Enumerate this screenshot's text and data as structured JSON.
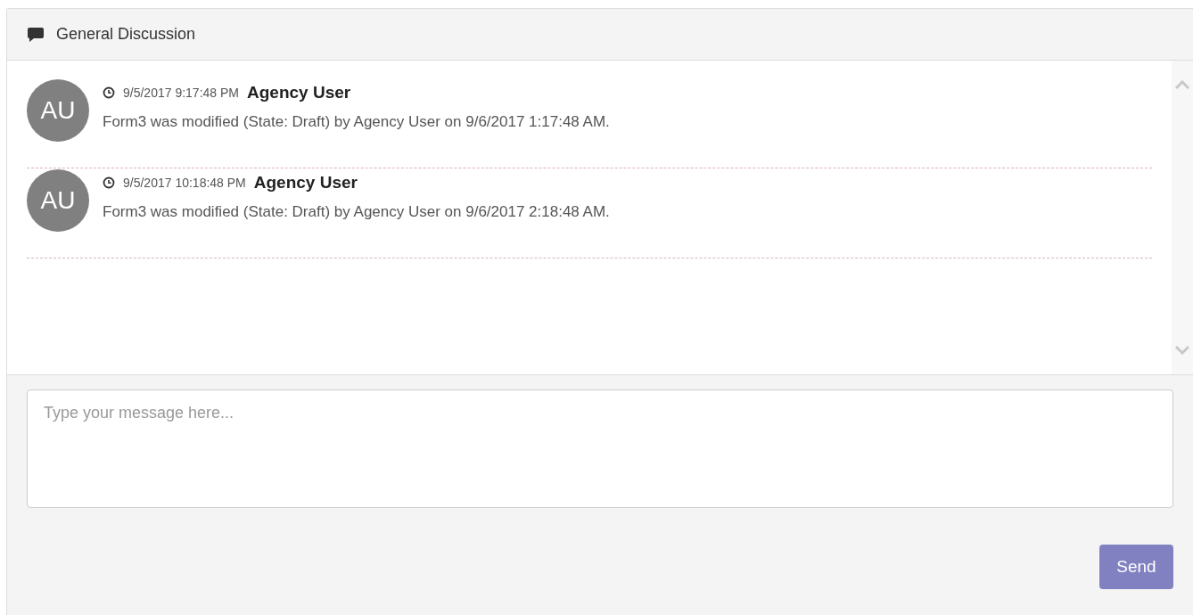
{
  "panel": {
    "title": "General Discussion"
  },
  "messages": [
    {
      "initials": "AU",
      "time": "9/5/2017 9:17:48 PM",
      "author": "Agency User",
      "text": "Form3 was modified (State: Draft) by Agency User on 9/6/2017 1:17:48 AM."
    },
    {
      "initials": "AU",
      "time": "9/5/2017 10:18:48 PM",
      "author": "Agency User",
      "text": "Form3 was modified (State: Draft) by Agency User on 9/6/2017 2:18:48 AM."
    }
  ],
  "composer": {
    "placeholder": "Type your message here...",
    "send": "Send"
  }
}
